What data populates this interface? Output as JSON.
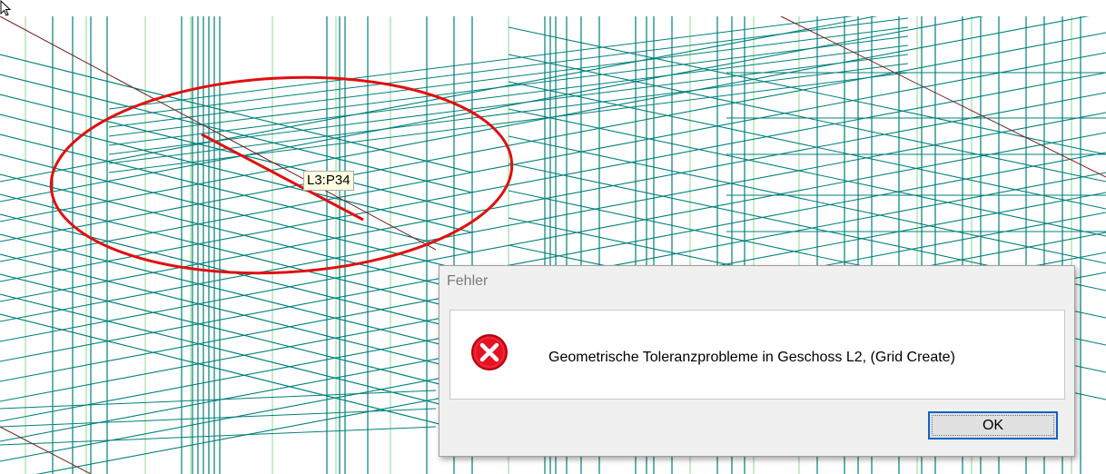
{
  "viewport": {
    "label_tag": "L3:P34",
    "colors": {
      "structure_lines": "#00807a",
      "grid_lines": "#90d890",
      "axis_line": "#7a2020",
      "highlight": "#e01010"
    }
  },
  "dialog": {
    "title": "Fehler",
    "icon": "error-icon",
    "message": "Geometrische Toleranzprobleme in Geschoss L2, (Grid Create)",
    "ok_label": "OK"
  }
}
